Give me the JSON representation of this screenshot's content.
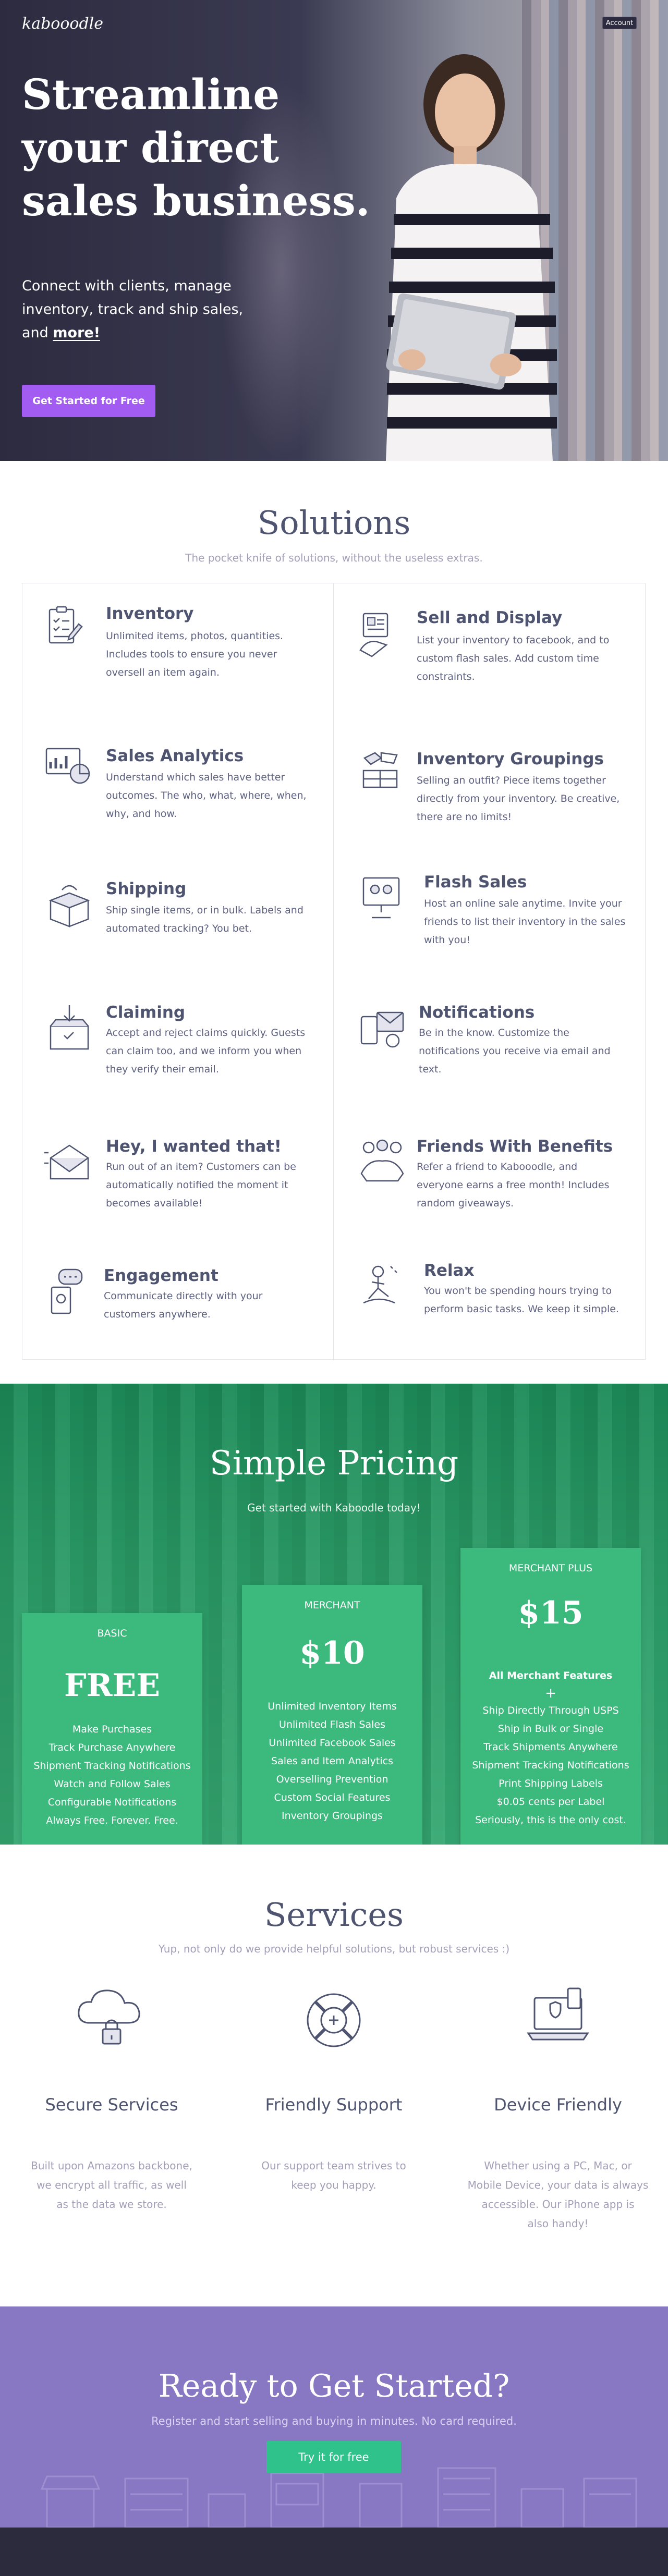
{
  "header": {
    "logo": "kabooodle",
    "account_label": "Account"
  },
  "hero": {
    "headline": "Streamline your direct sales business.",
    "sub_line1": "Connect with clients, manage",
    "sub_line2": "inventory, track and ship sales,",
    "sub_and": "and",
    "sub_more": "more!",
    "cta_label": "Get Started for Free"
  },
  "solutions": {
    "title": "Solutions",
    "subtitle": "The pocket knife of solutions, without the useless extras.",
    "items": [
      {
        "title": "Inventory",
        "desc": "Unlimited items, photos, quantities. Includes tools to ensure you never oversell an item again.",
        "icon": "clipboard-icon"
      },
      {
        "title": "Sell and Display",
        "desc": "List your inventory to facebook, and to custom flash sales. Add custom time constraints.",
        "icon": "display-icon"
      },
      {
        "title": "Sales Analytics",
        "desc": "Understand which sales have better outcomes. The who, what, where, when, why, and how.",
        "icon": "analytics-icon"
      },
      {
        "title": "Inventory Groupings",
        "desc": "Selling an outfit? Piece items together directly from your inventory. Be creative, there are no limits!",
        "icon": "groupings-icon"
      },
      {
        "title": "Shipping",
        "desc": "Ship single items, or in bulk. Labels and automated tracking? You bet.",
        "icon": "box-icon"
      },
      {
        "title": "Flash Sales",
        "desc": "Host an online sale anytime.  Invite your friends to list their inventory in the sales with you!",
        "icon": "flash-sale-icon"
      },
      {
        "title": "Claiming",
        "desc": "Accept and reject claims quickly.  Guests can claim too, and we inform you when they verify their email.",
        "icon": "claim-box-icon"
      },
      {
        "title": "Notifications",
        "desc": "Be in the know.  Customize the notifications you receive via email and text.",
        "icon": "notification-icon"
      },
      {
        "title": "Hey, I wanted that!",
        "desc": "Run out of an item? Customers can be automatically notified the moment it becomes available!",
        "icon": "mail-alert-icon"
      },
      {
        "title": "Friends With Benefits",
        "desc": "Refer a friend to Kabooodle, and everyone earns a free month! Includes random giveaways.",
        "icon": "friends-icon"
      },
      {
        "title": "Engagement",
        "desc": "Communicate directly with your customers anywhere.",
        "icon": "chat-icon"
      },
      {
        "title": "Relax",
        "desc": "You won't be spending hours trying to perform basic tasks.  We keep it simple.",
        "icon": "relax-icon"
      }
    ]
  },
  "pricing": {
    "title": "Simple Pricing",
    "subtitle": "Get started with Kaboodle today!",
    "plans": [
      {
        "name": "BASIC",
        "price": "FREE",
        "features": [
          "Make Purchases",
          "Track Purchase Anywhere",
          "Shipment Tracking Notifications",
          "Watch and Follow Sales",
          "Configurable Notifications",
          "Always Free. Forever. Free."
        ]
      },
      {
        "name": "MERCHANT",
        "price": "$10",
        "features": [
          "Unlimited Inventory Items",
          "Unlimited Flash Sales",
          "Unlimited Facebook Sales",
          "Sales and Item Analytics",
          "Overselling Prevention",
          "Custom Social Features",
          "Inventory Groupings"
        ]
      },
      {
        "name": "MERCHANT PLUS",
        "price": "$15",
        "lead": "All Merchant Features",
        "plus": "+",
        "features": [
          "Ship Directly Through USPS",
          "Ship in Bulk or Single",
          "Track Shipments Anywhere",
          "Shipment Tracking Notifications",
          "Print Shipping Labels",
          "$0.05 cents per Label",
          "Seriously, this is the only cost."
        ]
      }
    ]
  },
  "services": {
    "title": "Services",
    "subtitle": "Yup, not only do we provide helpful solutions, but robust services :)",
    "items": [
      {
        "title": "Secure Services",
        "desc_lines": [
          "Built upon Amazons backbone,",
          "we encrypt all traffic, as well",
          "as the data we store."
        ],
        "icon": "cloud-lock-icon"
      },
      {
        "title": "Friendly Support",
        "desc_lines": [
          "Our support team strives to",
          "keep you happy."
        ],
        "icon": "lifebuoy-icon"
      },
      {
        "title": "Device Friendly",
        "desc_lines": [
          "Whether using a PC, Mac, or",
          "Mobile Device, your data is always",
          "accessible. Our iPhone app is",
          "also handy!"
        ],
        "icon": "laptop-icon"
      }
    ]
  },
  "cta": {
    "title": "Ready to Get Started?",
    "subtitle": "Register and start selling and buying in minutes. No card required.",
    "button": "Try it for free"
  },
  "colors": {
    "hero_dark": "#2d2b3f",
    "accent_purple": "#a25cf2",
    "pricing_green": "#2a9b66",
    "plan_green": "#3cb97d",
    "cta_purple": "#8878c4",
    "cta_button": "#2fc28a",
    "heading_slate": "#4f5570"
  }
}
